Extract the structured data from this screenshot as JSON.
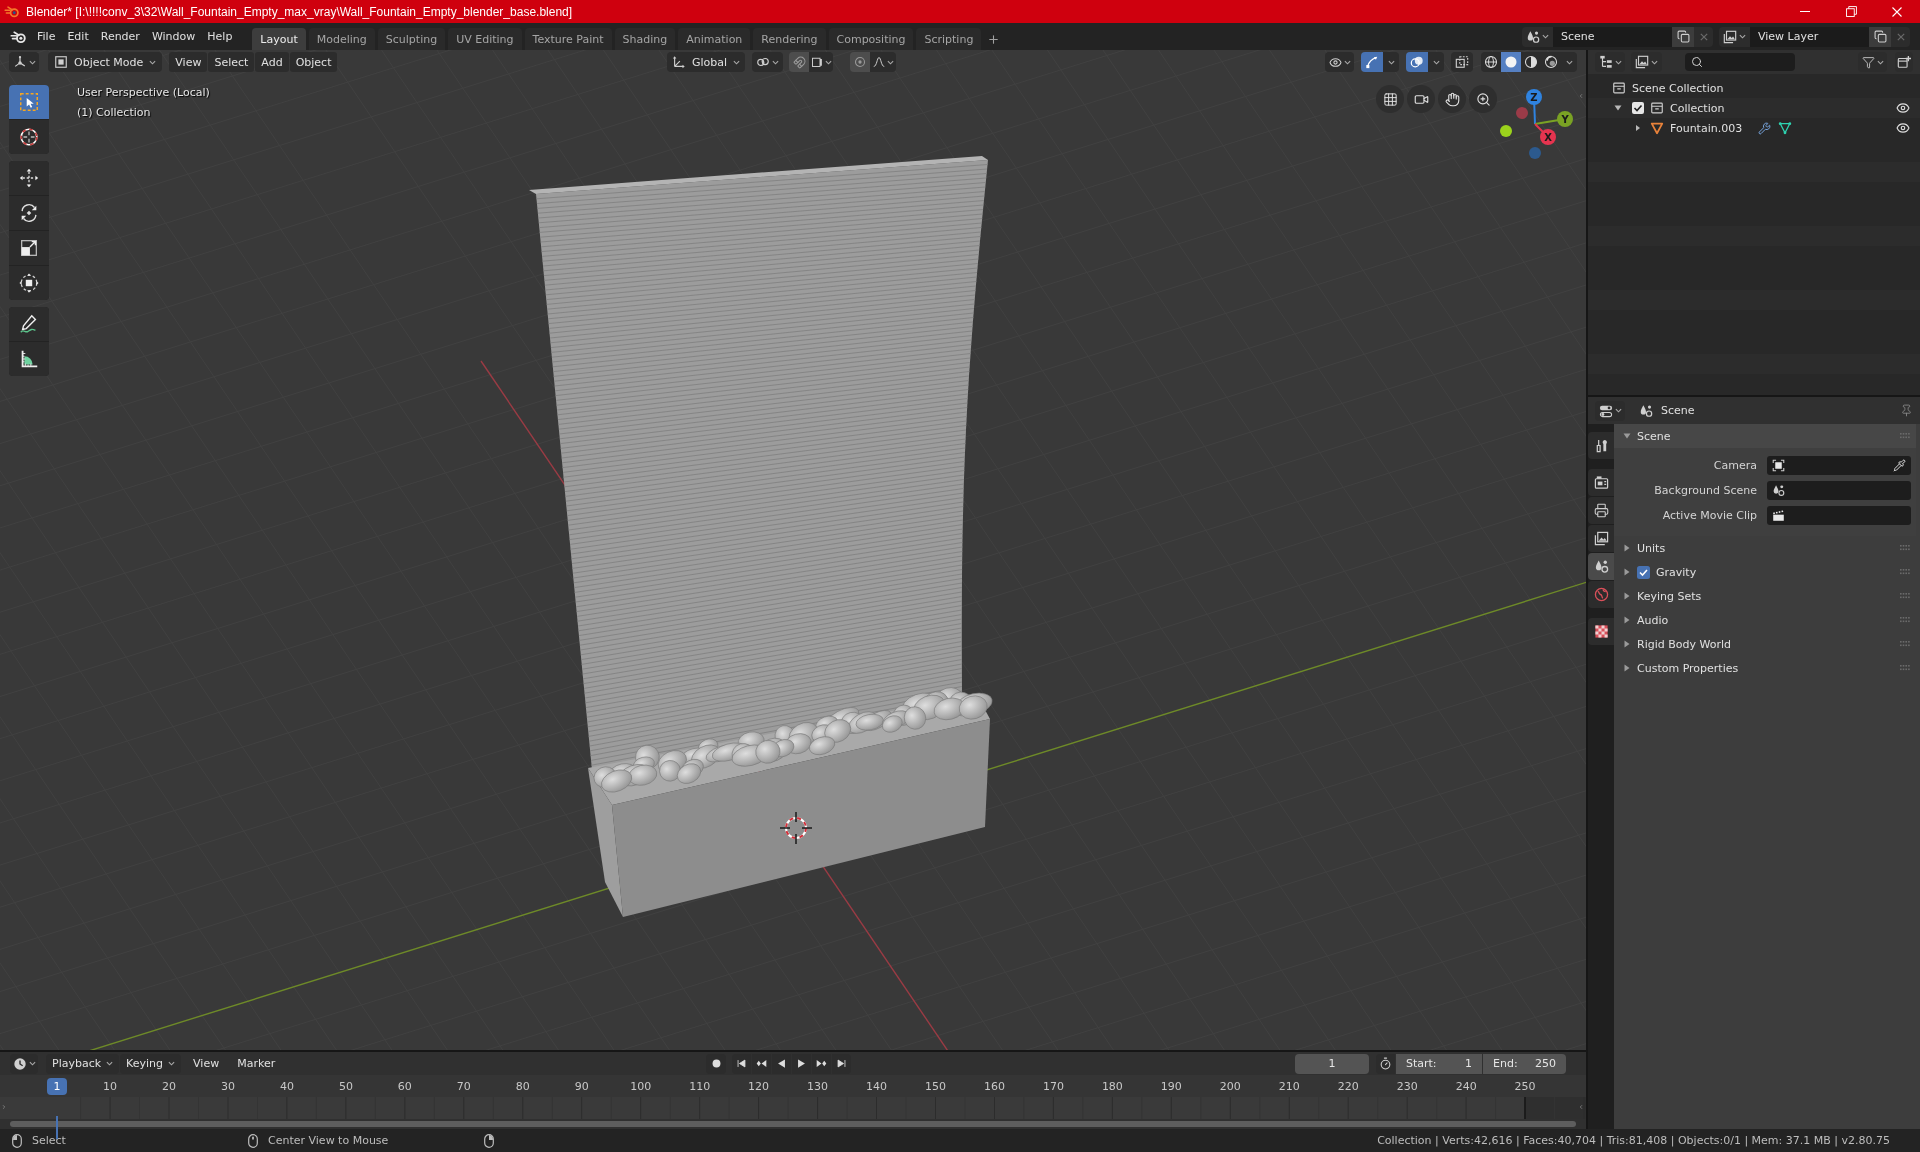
{
  "window": {
    "title": "Blender* [I:\\!!!!conv_3\\32\\Wall_Fountain_Empty_max_vray\\Wall_Fountain_Empty_blender_base.blend]"
  },
  "menu_bar": {
    "menus": [
      "File",
      "Edit",
      "Render",
      "Window",
      "Help"
    ]
  },
  "workspace_tabs": [
    {
      "label": "Layout",
      "selected": true
    },
    {
      "label": "Modeling",
      "selected": false
    },
    {
      "label": "Sculpting",
      "selected": false
    },
    {
      "label": "UV Editing",
      "selected": false
    },
    {
      "label": "Texture Paint",
      "selected": false
    },
    {
      "label": "Shading",
      "selected": false
    },
    {
      "label": "Animation",
      "selected": false
    },
    {
      "label": "Rendering",
      "selected": false
    },
    {
      "label": "Compositing",
      "selected": false
    },
    {
      "label": "Scripting",
      "selected": false
    }
  ],
  "scene_selector": {
    "value": "Scene"
  },
  "view_layer_selector": {
    "value": "View Layer"
  },
  "viewport": {
    "mode": "Object Mode",
    "menus": [
      "View",
      "Select",
      "Add",
      "Object"
    ],
    "orientation": "Global",
    "toggles": [
      {
        "kind": "gizmos",
        "on": true
      },
      {
        "kind": "overlays",
        "on": true
      },
      {
        "kind": "xray",
        "on": false
      }
    ],
    "shading": [
      {
        "kind": "wireframe",
        "selected": false
      },
      {
        "kind": "solid",
        "selected": true
      },
      {
        "kind": "material",
        "selected": false
      },
      {
        "kind": "rendered",
        "selected": false
      }
    ],
    "info": [
      "User Perspective (Local)",
      "(1) Collection"
    ],
    "tool_groups": [
      [
        {
          "kind": "select_box",
          "selected": true
        },
        {
          "kind": "cursor",
          "selected": false
        }
      ],
      [
        {
          "kind": "move",
          "selected": false
        },
        {
          "kind": "rotate",
          "selected": false
        },
        {
          "kind": "scale",
          "selected": false
        },
        {
          "kind": "transform",
          "selected": false
        }
      ],
      [
        {
          "kind": "annotate",
          "selected": false
        },
        {
          "kind": "measure",
          "selected": false
        }
      ]
    ],
    "gizmo_axes": [
      {
        "kind": "z",
        "label": "Z"
      },
      {
        "kind": "y",
        "label": "Y"
      },
      {
        "kind": "x",
        "label": "X"
      }
    ]
  },
  "outliner": {
    "tree": [
      {
        "kind": "scene_collection",
        "label": "Scene Collection",
        "children": [
          {
            "kind": "collection",
            "label": "Collection",
            "expanded": true,
            "checked": true,
            "visible": true,
            "children": [
              {
                "kind": "mesh_object",
                "label": "Fountain.003",
                "expanded": false,
                "visible": true,
                "badges": [
                  {
                    "kind": "modifier"
                  },
                  {
                    "kind": "mesh_data"
                  }
                ]
              }
            ]
          }
        ]
      }
    ]
  },
  "properties": {
    "title": "Scene",
    "tab_groups": [
      [
        {
          "kind": "tool",
          "selected": false
        }
      ],
      [
        {
          "kind": "render",
          "selected": false
        },
        {
          "kind": "output",
          "selected": false
        },
        {
          "kind": "view_layer",
          "selected": false
        },
        {
          "kind": "scene",
          "selected": true
        },
        {
          "kind": "world",
          "selected": false
        }
      ],
      [
        {
          "kind": "texture",
          "selected": false
        }
      ]
    ],
    "panels": [
      {
        "title": "Scene",
        "expanded": true,
        "fields": [
          {
            "label": "Camera",
            "kind": "object"
          },
          {
            "label": "Background Scene",
            "kind": "scene"
          },
          {
            "label": "Active Movie Clip",
            "kind": "clip"
          }
        ]
      },
      {
        "title": "Units",
        "expanded": false
      },
      {
        "title": "Gravity",
        "expanded": false,
        "checked": true
      },
      {
        "title": "Keying Sets",
        "expanded": false
      },
      {
        "title": "Audio",
        "expanded": false
      },
      {
        "title": "Rigid Body World",
        "expanded": false
      },
      {
        "title": "Custom Properties",
        "expanded": false
      }
    ]
  },
  "timeline": {
    "dropdowns": [
      "Playback",
      "Keying"
    ],
    "menus": [
      "View",
      "Marker"
    ],
    "current_frame": "1",
    "start": {
      "label": "Start:",
      "value": "1"
    },
    "end": {
      "label": "End:",
      "value": "250"
    },
    "playhead_label": "1",
    "ticks": [
      "10",
      "20",
      "30",
      "40",
      "50",
      "60",
      "70",
      "80",
      "90",
      "100",
      "110",
      "120",
      "130",
      "140",
      "150",
      "160",
      "170",
      "180",
      "190",
      "200",
      "210",
      "220",
      "230",
      "240",
      "250"
    ]
  },
  "status_bar": {
    "hints": [
      {
        "kind": "left_click",
        "label": "Select"
      },
      {
        "kind": "middle_click",
        "label": "Center View to Mouse"
      },
      {
        "kind": "right_click"
      }
    ],
    "stats": "Collection | Verts:42,616 | Faces:40,704 | Tris:81,408 | Objects:0/1 | Mem: 37.1 MB | v2.80.75"
  }
}
